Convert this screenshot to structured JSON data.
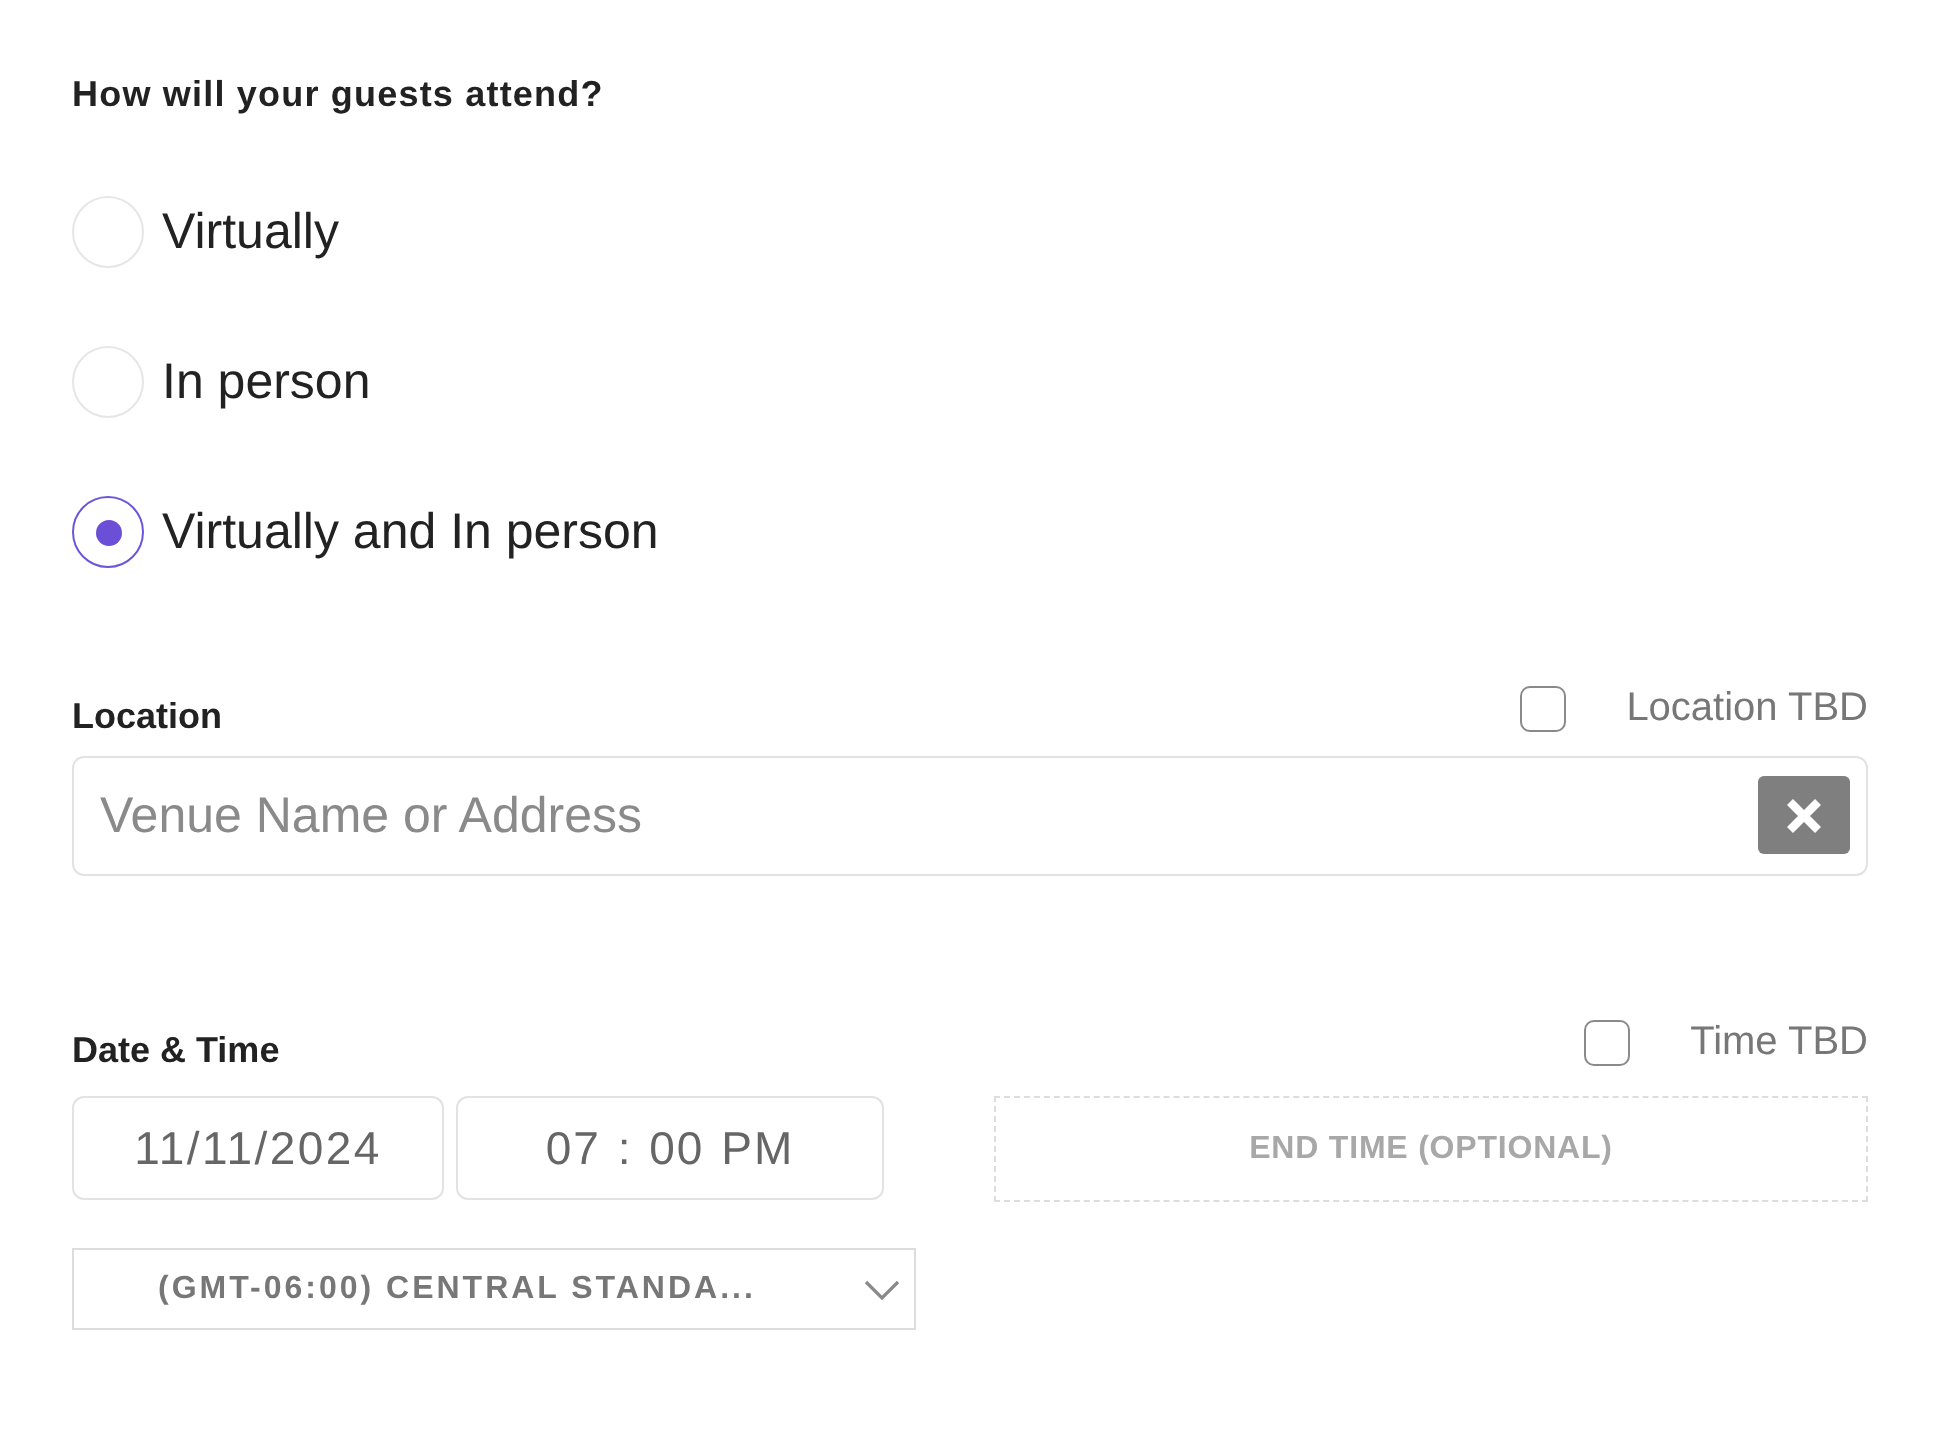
{
  "attendance": {
    "question": "How will your guests attend?",
    "options": [
      {
        "label": "Virtually",
        "selected": false
      },
      {
        "label": "In person",
        "selected": false
      },
      {
        "label": "Virtually and In person",
        "selected": true
      }
    ]
  },
  "location": {
    "label": "Location",
    "tbd": {
      "label": "Location TBD",
      "checked": false
    },
    "field": {
      "placeholder": "Venue Name or Address"
    }
  },
  "date_time": {
    "label": "Date & Time",
    "tbd": {
      "label": "Time TBD",
      "checked": false
    },
    "date": {
      "value": "11/11/2024"
    },
    "start_time": {
      "value": "07 : 00 PM"
    },
    "end_time": {
      "placeholder": "END TIME (OPTIONAL)",
      "disabled": true
    },
    "timezone": {
      "value": "(GMT-06:00) CENTRAL STANDA..."
    }
  }
}
